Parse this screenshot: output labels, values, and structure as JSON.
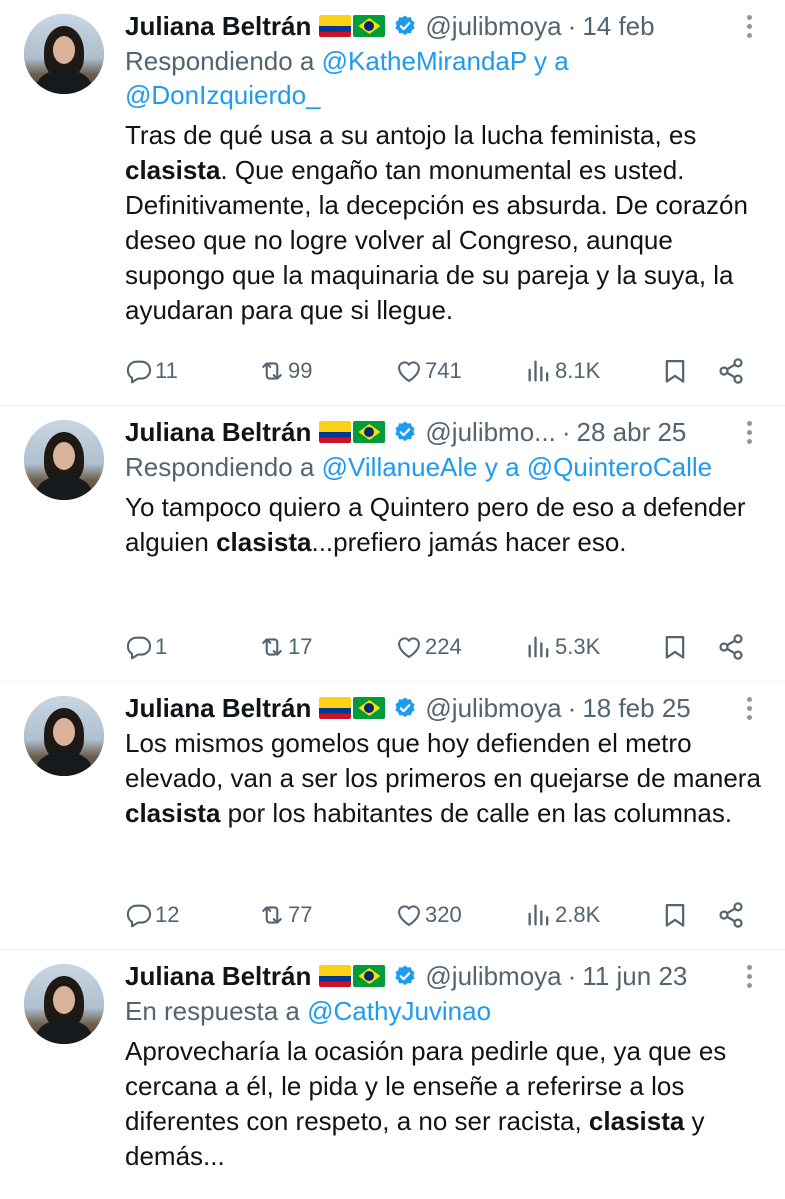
{
  "tweets": [
    {
      "author": "Juliana Beltrán",
      "handle": "@julibmoya",
      "date": "14 feb",
      "reply_prefix": "Respondiendo a",
      "reply_to_1": "@KatheMirandaP",
      "reply_joiner": " y a",
      "reply_to_2": "@DonIzquierdo_",
      "text_1": "Tras de qué usa a su antojo la lucha feminista, es ",
      "bold": "clasista",
      "text_2": ". Que engaño tan monumental es usted. Definitivamente, la decepción es absurda. De corazón deseo que no logre volver al Congreso, aunque supongo que la maquinaria de su pareja y la suya, la ayudaran para que si llegue.",
      "replies": "11",
      "reposts": "99",
      "likes": "741",
      "views": "8.1K"
    },
    {
      "author": "Juliana Beltrán",
      "handle": "@julibmo...",
      "date": "28 abr 25",
      "reply_prefix": "Respondiendo a",
      "reply_to_1": "@VillanueAle",
      "reply_joiner": " y a ",
      "reply_to_2": "@QuinteroCalle",
      "text_1": "Yo tampoco quiero a Quintero pero de eso a defender alguien ",
      "bold": "clasista",
      "text_2": "...prefiero jamás hacer eso.",
      "replies": "1",
      "reposts": "17",
      "likes": "224",
      "views": "5.3K"
    },
    {
      "author": "Juliana Beltrán",
      "handle": "@julibmoya",
      "date": "18 feb 25",
      "text_1": "Los mismos gomelos que hoy defienden el metro elevado, van a ser los primeros en quejarse de manera ",
      "bold": "clasista",
      "text_2": " por los habitantes de calle en las columnas.",
      "replies": "12",
      "reposts": "77",
      "likes": "320",
      "views": "2.8K"
    },
    {
      "author": "Juliana Beltrán",
      "handle": "@julibmoya",
      "date": "11 jun 23",
      "reply_prefix": "En respuesta a",
      "reply_to_1": "@CathyJuvinao",
      "text_1": "Aprovecharía la ocasión para pedirle que, ya que es cercana a él, le pida y le enseñe a referirse a los diferentes con respeto, a no ser racista, ",
      "bold": "clasista",
      "text_2": " y demás..."
    }
  ],
  "dot": "·",
  "icons": {
    "reply": "reply-icon",
    "repost": "repost-icon",
    "like": "heart-icon",
    "views": "views-icon",
    "bookmark": "bookmark-icon",
    "share": "share-icon",
    "verified": "verified-badge-icon",
    "more": "more-options-icon",
    "flag_1": "colombia-flag-icon",
    "flag_2": "brazil-flag-icon"
  },
  "colors": {
    "link": "#1d9bf0",
    "secondary_text": "#536471",
    "verified": "#1d9bf0"
  }
}
